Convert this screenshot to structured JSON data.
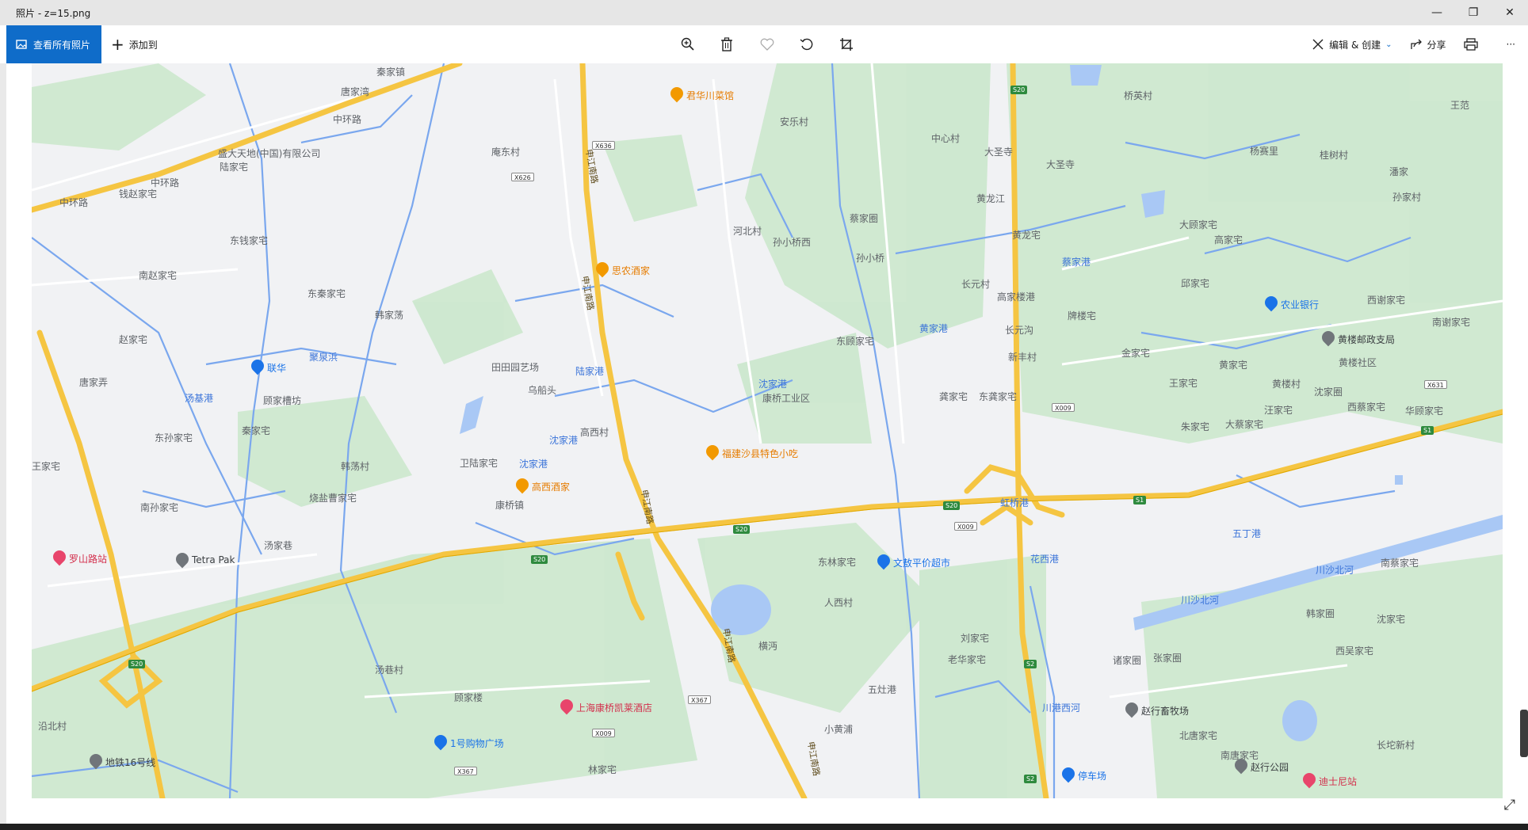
{
  "window": {
    "title": "照片 - z=15.png"
  },
  "toolbar": {
    "view_all_label": "查看所有照片",
    "add_to_label": "添加到",
    "edit_create_label": "编辑 & 创建",
    "share_label": "分享",
    "more_label": "···"
  },
  "map": {
    "labels_gray": [
      [
        "秦家镇",
        475,
        90
      ],
      [
        "唐家湾",
        430,
        115
      ],
      [
        "中环路",
        420,
        150
      ],
      [
        "中环路",
        190,
        230
      ],
      [
        "中环路",
        75,
        255
      ],
      [
        "盛大天地(中国)有限公司",
        275,
        193
      ],
      [
        "陆家宅",
        277,
        210
      ],
      [
        "钱赵家宅",
        150,
        244
      ],
      [
        "东钱家宅",
        290,
        303
      ],
      [
        "南赵家宅",
        175,
        347
      ],
      [
        "东秦家宅",
        388,
        370
      ],
      [
        "韩家荡",
        473,
        397
      ],
      [
        "赵家宅",
        150,
        428
      ],
      [
        "唐家弄",
        100,
        482
      ],
      [
        "顾家槽坊",
        332,
        505
      ],
      [
        "东孙家宅",
        195,
        552
      ],
      [
        "秦家宅",
        305,
        543
      ],
      [
        "王家宅",
        40,
        588
      ],
      [
        "南孙家宅",
        177,
        640
      ],
      [
        "汤家巷",
        333,
        688
      ],
      [
        "烧盐曹家宅",
        390,
        628
      ],
      [
        "韩荡村",
        430,
        588
      ],
      [
        "卫陆家宅",
        580,
        584
      ],
      [
        "康桥镇",
        625,
        637
      ],
      [
        "高西村",
        732,
        545
      ],
      [
        "乌船头",
        666,
        492
      ],
      [
        "田田园艺场",
        620,
        463
      ],
      [
        "庵东村",
        620,
        191
      ],
      [
        "河北村",
        925,
        291
      ],
      [
        "孙小桥西",
        975,
        305
      ],
      [
        "孙小桥",
        1080,
        325
      ],
      [
        "蔡家圈",
        1072,
        275
      ],
      [
        "安乐村",
        984,
        153
      ],
      [
        "中心村",
        1175,
        174
      ],
      [
        "大圣寺",
        1242,
        191
      ],
      [
        "黄龙江",
        1232,
        250
      ],
      [
        "黄龙宅",
        1277,
        296
      ],
      [
        "长元村",
        1213,
        358
      ],
      [
        "高家楼港",
        1258,
        374
      ],
      [
        "长元沟",
        1268,
        416
      ],
      [
        "新丰村",
        1272,
        450
      ],
      [
        "牌楼宅",
        1347,
        398
      ],
      [
        "东顾家宅",
        1055,
        430
      ],
      [
        "龚家宅",
        1185,
        500
      ],
      [
        "东龚家宅",
        1235,
        500
      ],
      [
        "康桥工业区",
        962,
        502
      ],
      [
        "东林家宅",
        1032,
        709
      ],
      [
        "人西村",
        1040,
        760
      ],
      [
        "横沔",
        957,
        815
      ],
      [
        "刘家宅",
        1212,
        805
      ],
      [
        "老华家宅",
        1196,
        832
      ],
      [
        "五灶港",
        1095,
        870
      ],
      [
        "小黄浦",
        1040,
        920
      ],
      [
        "汤巷村",
        473,
        845
      ],
      [
        "顾家楼",
        573,
        880
      ],
      [
        "林家宅",
        742,
        971
      ],
      [
        "沿北村",
        48,
        916
      ],
      [
        "桥英村",
        1418,
        120
      ],
      [
        "大圣寺",
        1320,
        207
      ],
      [
        "杨赛里",
        1577,
        190
      ],
      [
        "桂树村",
        1665,
        195
      ],
      [
        "孙家村",
        1757,
        248
      ],
      [
        "潘家",
        1753,
        216
      ],
      [
        "大顾家宅",
        1488,
        283
      ],
      [
        "高家宅",
        1532,
        302
      ],
      [
        "邱家宅",
        1490,
        357
      ],
      [
        "西谢家宅",
        1725,
        378
      ],
      [
        "南谢家宅",
        1807,
        406
      ],
      [
        "金家宅",
        1415,
        445
      ],
      [
        "黄家宅",
        1538,
        460
      ],
      [
        "王家宅",
        1475,
        483
      ],
      [
        "黄楼村",
        1605,
        484
      ],
      [
        "沈家圈",
        1658,
        494
      ],
      [
        "黄楼社区",
        1689,
        457
      ],
      [
        "汪家宅",
        1595,
        517
      ],
      [
        "西蔡家宅",
        1700,
        513
      ],
      [
        "朱家宅",
        1490,
        538
      ],
      [
        "大蔡家宅",
        1546,
        535
      ],
      [
        "华顾家宅",
        1773,
        518
      ],
      [
        "南蔡家宅",
        1742,
        710
      ],
      [
        "韩家圈",
        1648,
        774
      ],
      [
        "沈家宅",
        1737,
        781
      ],
      [
        "西吴家宅",
        1685,
        821
      ],
      [
        "诸家圈",
        1404,
        833
      ],
      [
        "张家圈",
        1455,
        830
      ],
      [
        "北唐家宅",
        1488,
        928
      ],
      [
        "南唐家宅",
        1540,
        953
      ],
      [
        "长坨新村",
        1737,
        940
      ],
      [
        "王范",
        1830,
        132
      ]
    ],
    "labels_water": [
      [
        "汤基港",
        233,
        502
      ],
      [
        "聚泉浜",
        390,
        450
      ],
      [
        "沈家港",
        655,
        585
      ],
      [
        "沈家港",
        957,
        484
      ],
      [
        "陆家港",
        726,
        468
      ],
      [
        "沈家港",
        693,
        555
      ],
      [
        "川沙北河",
        1490,
        757
      ],
      [
        "川沙北河",
        1660,
        719
      ],
      [
        "五丁港",
        1555,
        673
      ],
      [
        "川港西河",
        1315,
        893
      ],
      [
        "蔡家港",
        1340,
        330
      ],
      [
        "黄家港",
        1160,
        414
      ],
      [
        "虹桥港",
        1262,
        634
      ],
      [
        "花西港",
        1300,
        705
      ]
    ],
    "labels_road": [
      [
        "申江南路",
        725,
        210
      ],
      [
        "申江南路",
        720,
        370
      ],
      [
        "申江南路",
        795,
        640
      ],
      [
        "申江南路",
        898,
        815
      ],
      [
        "申江南路",
        1005,
        958
      ]
    ],
    "pois": [
      [
        "君华川菜馆",
        "o",
        866,
        120
      ],
      [
        "思农酒家",
        "o",
        772,
        341
      ],
      [
        "福建沙县特色小吃",
        "o",
        911,
        572
      ],
      [
        "高西酒家",
        "o",
        671,
        614
      ],
      [
        "联华",
        "b",
        337,
        464
      ],
      [
        "文敖平价超市",
        "b",
        1127,
        710
      ],
      [
        "农业银行",
        "b",
        1616,
        384
      ],
      [
        "1号购物广场",
        "b",
        568,
        938
      ],
      [
        "停车场",
        "b",
        1360,
        979
      ],
      [
        "上海康桥凯莱酒店",
        "r",
        727,
        893
      ],
      [
        "罗山路站",
        "r",
        87,
        705
      ],
      [
        "迪士尼站",
        "r",
        1664,
        986
      ],
      [
        "Tetra Pak",
        "g",
        242,
        708
      ],
      [
        "黄楼邮政支局",
        "g",
        1688,
        428
      ],
      [
        "赵行畜牧场",
        "g",
        1440,
        897
      ],
      [
        "赵行公园",
        "g",
        1578,
        968
      ],
      [
        "地铁16号线",
        "g",
        133,
        962
      ]
    ],
    "shields": [
      [
        "S20",
        1275,
        113
      ],
      [
        "S20",
        925,
        668
      ],
      [
        "S20",
        670,
        706
      ],
      [
        "S20",
        1190,
        638
      ],
      [
        "S20",
        162,
        838
      ],
      [
        "S1",
        1430,
        631
      ],
      [
        "S1",
        1793,
        543
      ],
      [
        "S2",
        1292,
        838
      ],
      [
        "S2",
        1292,
        983
      ]
    ],
    "white_shields": [
      [
        "X636",
        747,
        183
      ],
      [
        "X626",
        645,
        223
      ],
      [
        "X009",
        1327,
        514
      ],
      [
        "X009",
        1204,
        664
      ],
      [
        "X367",
        868,
        883
      ],
      [
        "X009",
        747,
        925
      ],
      [
        "X367",
        573,
        973
      ],
      [
        "X631",
        1797,
        485
      ]
    ]
  }
}
